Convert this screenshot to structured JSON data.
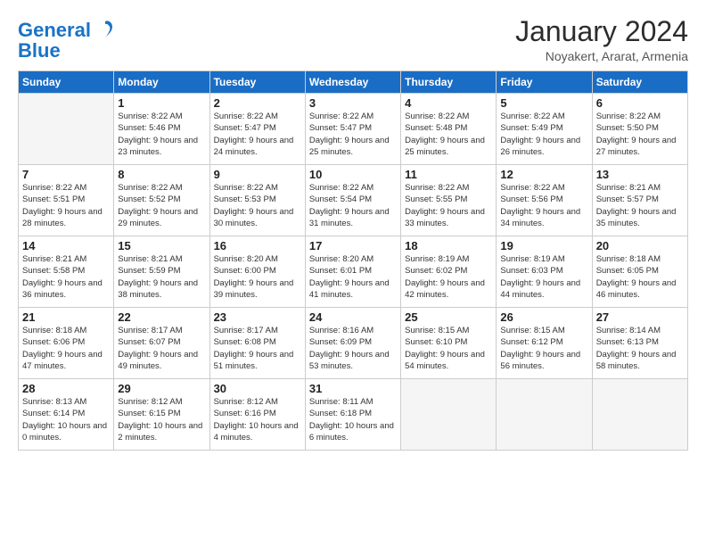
{
  "logo": {
    "line1": "General",
    "line2": "Blue"
  },
  "title": "January 2024",
  "location": "Noyakert, Ararat, Armenia",
  "weekdays": [
    "Sunday",
    "Monday",
    "Tuesday",
    "Wednesday",
    "Thursday",
    "Friday",
    "Saturday"
  ],
  "weeks": [
    [
      {
        "day": "",
        "sunrise": "",
        "sunset": "",
        "daylight": ""
      },
      {
        "day": "1",
        "sunrise": "Sunrise: 8:22 AM",
        "sunset": "Sunset: 5:46 PM",
        "daylight": "Daylight: 9 hours and 23 minutes."
      },
      {
        "day": "2",
        "sunrise": "Sunrise: 8:22 AM",
        "sunset": "Sunset: 5:47 PM",
        "daylight": "Daylight: 9 hours and 24 minutes."
      },
      {
        "day": "3",
        "sunrise": "Sunrise: 8:22 AM",
        "sunset": "Sunset: 5:47 PM",
        "daylight": "Daylight: 9 hours and 25 minutes."
      },
      {
        "day": "4",
        "sunrise": "Sunrise: 8:22 AM",
        "sunset": "Sunset: 5:48 PM",
        "daylight": "Daylight: 9 hours and 25 minutes."
      },
      {
        "day": "5",
        "sunrise": "Sunrise: 8:22 AM",
        "sunset": "Sunset: 5:49 PM",
        "daylight": "Daylight: 9 hours and 26 minutes."
      },
      {
        "day": "6",
        "sunrise": "Sunrise: 8:22 AM",
        "sunset": "Sunset: 5:50 PM",
        "daylight": "Daylight: 9 hours and 27 minutes."
      }
    ],
    [
      {
        "day": "7",
        "sunrise": "Sunrise: 8:22 AM",
        "sunset": "Sunset: 5:51 PM",
        "daylight": "Daylight: 9 hours and 28 minutes."
      },
      {
        "day": "8",
        "sunrise": "Sunrise: 8:22 AM",
        "sunset": "Sunset: 5:52 PM",
        "daylight": "Daylight: 9 hours and 29 minutes."
      },
      {
        "day": "9",
        "sunrise": "Sunrise: 8:22 AM",
        "sunset": "Sunset: 5:53 PM",
        "daylight": "Daylight: 9 hours and 30 minutes."
      },
      {
        "day": "10",
        "sunrise": "Sunrise: 8:22 AM",
        "sunset": "Sunset: 5:54 PM",
        "daylight": "Daylight: 9 hours and 31 minutes."
      },
      {
        "day": "11",
        "sunrise": "Sunrise: 8:22 AM",
        "sunset": "Sunset: 5:55 PM",
        "daylight": "Daylight: 9 hours and 33 minutes."
      },
      {
        "day": "12",
        "sunrise": "Sunrise: 8:22 AM",
        "sunset": "Sunset: 5:56 PM",
        "daylight": "Daylight: 9 hours and 34 minutes."
      },
      {
        "day": "13",
        "sunrise": "Sunrise: 8:21 AM",
        "sunset": "Sunset: 5:57 PM",
        "daylight": "Daylight: 9 hours and 35 minutes."
      }
    ],
    [
      {
        "day": "14",
        "sunrise": "Sunrise: 8:21 AM",
        "sunset": "Sunset: 5:58 PM",
        "daylight": "Daylight: 9 hours and 36 minutes."
      },
      {
        "day": "15",
        "sunrise": "Sunrise: 8:21 AM",
        "sunset": "Sunset: 5:59 PM",
        "daylight": "Daylight: 9 hours and 38 minutes."
      },
      {
        "day": "16",
        "sunrise": "Sunrise: 8:20 AM",
        "sunset": "Sunset: 6:00 PM",
        "daylight": "Daylight: 9 hours and 39 minutes."
      },
      {
        "day": "17",
        "sunrise": "Sunrise: 8:20 AM",
        "sunset": "Sunset: 6:01 PM",
        "daylight": "Daylight: 9 hours and 41 minutes."
      },
      {
        "day": "18",
        "sunrise": "Sunrise: 8:19 AM",
        "sunset": "Sunset: 6:02 PM",
        "daylight": "Daylight: 9 hours and 42 minutes."
      },
      {
        "day": "19",
        "sunrise": "Sunrise: 8:19 AM",
        "sunset": "Sunset: 6:03 PM",
        "daylight": "Daylight: 9 hours and 44 minutes."
      },
      {
        "day": "20",
        "sunrise": "Sunrise: 8:18 AM",
        "sunset": "Sunset: 6:05 PM",
        "daylight": "Daylight: 9 hours and 46 minutes."
      }
    ],
    [
      {
        "day": "21",
        "sunrise": "Sunrise: 8:18 AM",
        "sunset": "Sunset: 6:06 PM",
        "daylight": "Daylight: 9 hours and 47 minutes."
      },
      {
        "day": "22",
        "sunrise": "Sunrise: 8:17 AM",
        "sunset": "Sunset: 6:07 PM",
        "daylight": "Daylight: 9 hours and 49 minutes."
      },
      {
        "day": "23",
        "sunrise": "Sunrise: 8:17 AM",
        "sunset": "Sunset: 6:08 PM",
        "daylight": "Daylight: 9 hours and 51 minutes."
      },
      {
        "day": "24",
        "sunrise": "Sunrise: 8:16 AM",
        "sunset": "Sunset: 6:09 PM",
        "daylight": "Daylight: 9 hours and 53 minutes."
      },
      {
        "day": "25",
        "sunrise": "Sunrise: 8:15 AM",
        "sunset": "Sunset: 6:10 PM",
        "daylight": "Daylight: 9 hours and 54 minutes."
      },
      {
        "day": "26",
        "sunrise": "Sunrise: 8:15 AM",
        "sunset": "Sunset: 6:12 PM",
        "daylight": "Daylight: 9 hours and 56 minutes."
      },
      {
        "day": "27",
        "sunrise": "Sunrise: 8:14 AM",
        "sunset": "Sunset: 6:13 PM",
        "daylight": "Daylight: 9 hours and 58 minutes."
      }
    ],
    [
      {
        "day": "28",
        "sunrise": "Sunrise: 8:13 AM",
        "sunset": "Sunset: 6:14 PM",
        "daylight": "Daylight: 10 hours and 0 minutes."
      },
      {
        "day": "29",
        "sunrise": "Sunrise: 8:12 AM",
        "sunset": "Sunset: 6:15 PM",
        "daylight": "Daylight: 10 hours and 2 minutes."
      },
      {
        "day": "30",
        "sunrise": "Sunrise: 8:12 AM",
        "sunset": "Sunset: 6:16 PM",
        "daylight": "Daylight: 10 hours and 4 minutes."
      },
      {
        "day": "31",
        "sunrise": "Sunrise: 8:11 AM",
        "sunset": "Sunset: 6:18 PM",
        "daylight": "Daylight: 10 hours and 6 minutes."
      },
      {
        "day": "",
        "sunrise": "",
        "sunset": "",
        "daylight": ""
      },
      {
        "day": "",
        "sunrise": "",
        "sunset": "",
        "daylight": ""
      },
      {
        "day": "",
        "sunrise": "",
        "sunset": "",
        "daylight": ""
      }
    ]
  ]
}
